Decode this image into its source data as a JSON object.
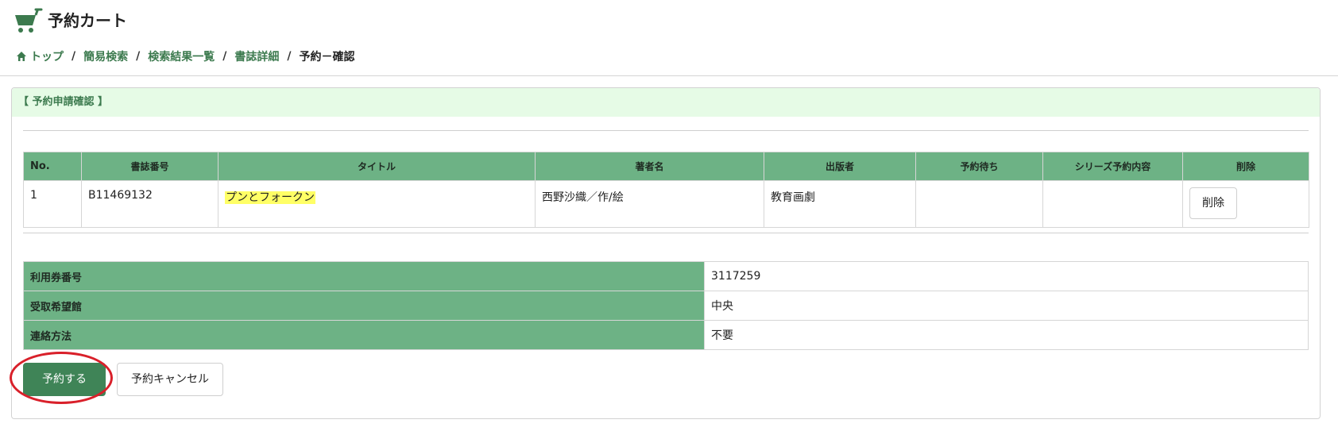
{
  "header": {
    "title": "予約カート",
    "icon": "shopping-cart-icon",
    "accent_color": "#3c7a4e"
  },
  "breadcrumb": {
    "items": [
      {
        "label": "トップ",
        "icon": "home-icon"
      },
      {
        "label": "簡易検索"
      },
      {
        "label": "検索結果一覧"
      },
      {
        "label": "書誌詳細"
      },
      {
        "label": "予約－確認",
        "current": true
      }
    ],
    "separator": "/"
  },
  "panel": {
    "heading": "【  予約申請確認  】"
  },
  "result_table": {
    "columns": [
      "No.",
      "書誌番号",
      "タイトル",
      "著者名",
      "出版者",
      "予約待ち",
      "シリーズ予約内容",
      "削除"
    ],
    "rows": [
      {
        "no": "1",
        "bib_id": "B11469132",
        "title": "プンとフォークン",
        "author": "西野沙織／作/絵",
        "publisher": "教育画劇",
        "waiting": "",
        "series": "",
        "delete_label": "削除"
      }
    ],
    "header_color": "#6db285",
    "title_highlight_color": "#ffff66"
  },
  "info_table": {
    "rows": [
      {
        "label": "利用券番号",
        "value": "3117259"
      },
      {
        "label": "受取希望館",
        "value": "中央"
      },
      {
        "label": "連絡方法",
        "value": "不要"
      }
    ]
  },
  "actions": {
    "reserve_label": "予約する",
    "cancel_label": "予約キャンセル",
    "primary_color": "#3f8457",
    "annotation_color": "#d9202a"
  }
}
